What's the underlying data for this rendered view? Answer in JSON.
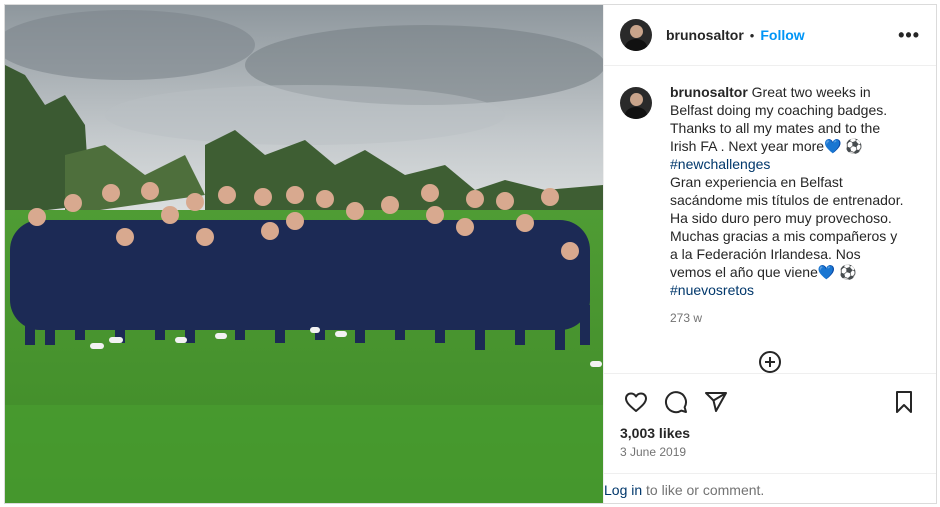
{
  "post": {
    "username": "brunosaltor",
    "separator": "•",
    "follow_label": "Follow",
    "more_icon": "more-dots-icon",
    "caption": {
      "line1": "Great two weeks in Belfast doing my coaching badges. Thanks to all my mates and to the Irish FA . Next year more",
      "emoji1": "💙 ⚽",
      "hashtag1": "#newchallenges",
      "line2": "Gran experiencia en Belfast sacándome mis títulos de entrenador. Ha sido duro pero muy provechoso. Muchas gracias a mis compañeros y a la Federación Irlandesa. Nos vemos el año que viene",
      "emoji2": "💙 ⚽",
      "hashtag2": "#nuevosretos"
    },
    "time_ago": "273 w",
    "likes": "3,003 likes",
    "date": "3 June 2019",
    "login_link": "Log in",
    "login_rest": " to like or comment."
  },
  "colors": {
    "accent": "#0095f6",
    "hashtag": "#00376b",
    "muted": "#737373"
  }
}
